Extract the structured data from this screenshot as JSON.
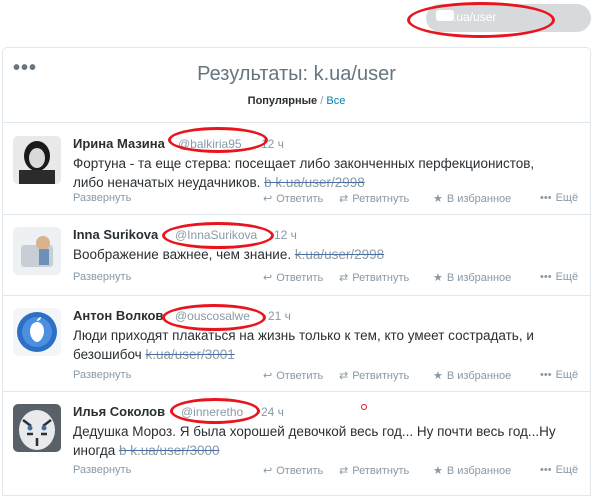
{
  "topbar": {
    "search_text": ".ua/user"
  },
  "header": {
    "more_icon": "•••",
    "title_prefix": "Результаты: ",
    "title_query": "k.ua/user",
    "tab_popular": "Популярные",
    "tab_separator": " / ",
    "tab_all": "Все"
  },
  "actions": {
    "expand": "Развернуть",
    "reply": "Ответить",
    "retweet": "Ретвитнуть",
    "favorite": "В избранное",
    "more": "Ещё"
  },
  "tweets": [
    {
      "name": "Ирина Мазина",
      "handle": "@balkiria95",
      "time": "12 ч",
      "line1": "Фортуна - та еще стерва: посещает либо законченных перфекционистов,",
      "line2_text": "либо неначатых неудачников. ",
      "link": "b  k.ua/user/2998"
    },
    {
      "name": "Inna Surikova",
      "handle": "@InnaSurikova",
      "time": "12 ч",
      "line1_text": "Воображение важнее, чем знание. ",
      "link": "k.ua/user/2998"
    },
    {
      "name": "Антон Волков",
      "handle": "@ouscosalwe",
      "time": "21 ч",
      "line1": "Люди приходят плакаться на жизнь только к тем, кто умеет сострадать, и",
      "line2_text": "безошибоч ",
      "link": "k.ua/user/3001"
    },
    {
      "name": "Илья Соколов",
      "handle": "@inneretho",
      "time": "24 ч",
      "line1": "Дедушка Мороз. Я была хорошей девочкой весь год... Ну почти весь год...Ну",
      "line2_text": "иногда ",
      "link": "b  k.ua/user/3000"
    }
  ],
  "colors": {
    "annotation": "#e8141e",
    "link": "#0084b4",
    "muted": "#8899a6",
    "text": "#292f33"
  }
}
